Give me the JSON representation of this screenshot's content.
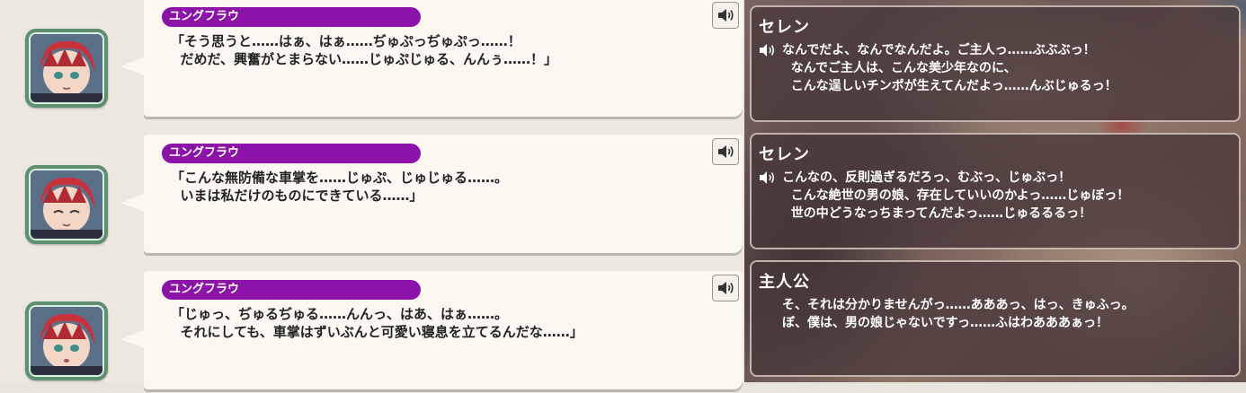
{
  "log": [
    {
      "speaker": "ユングフラウ",
      "text": "「そう思うと……はぁ、はぁ……ぢゅぷっぢゅぷっ……！\n  だめだ、興奮がとまらない……じゅぷじゅる、んんぅ……！」",
      "voice_icon": "speaker-icon"
    },
    {
      "speaker": "ユングフラウ",
      "text": "「こんな無防備な車掌を……じゅぷ、じゅじゅる……。\n  いまは私だけのものにできている……」",
      "voice_icon": "speaker-icon"
    },
    {
      "speaker": "ユングフラウ",
      "text": "「じゅっ、ぢゅるぢゅる……んんっ、はあ、はぁ……。\n  それにしても、車掌はずいぶんと可愛い寝息を立てるんだな……」",
      "voice_icon": "speaker-icon"
    }
  ],
  "scene": {
    "messages": [
      {
        "speaker": "セレン",
        "text": "なんでだよ、なんでなんだよ。ご主人っ……ぶぶぶっ！\n  なんでご主人は、こんな美少年なのに、\n  こんな逞しいチンポが生えてんだよっ……んぶじゅるっ！",
        "voiced": true
      },
      {
        "speaker": "セレン",
        "text": "こんなの、反則過ぎるだろっ、むぶっ、じゅぶっ！\n  こんな絶世の男の娘、存在していいのかよっ……じゅぼっ！\n  世の中どうなっちまってんだよっ……じゅるるるっ！",
        "voiced": true
      },
      {
        "speaker": "主人公",
        "text": "そ、それは分かりませんがっ……あああっ、はっ、きゅふっ。\nぼ、僕は、男の娘じゃないですっ……ふはわあああぁっ！",
        "voiced": false
      }
    ]
  },
  "colors": {
    "name_bar": "#8b13a7",
    "avatar_frame": "#5f8f70",
    "bubble": "#fbf8f2"
  }
}
